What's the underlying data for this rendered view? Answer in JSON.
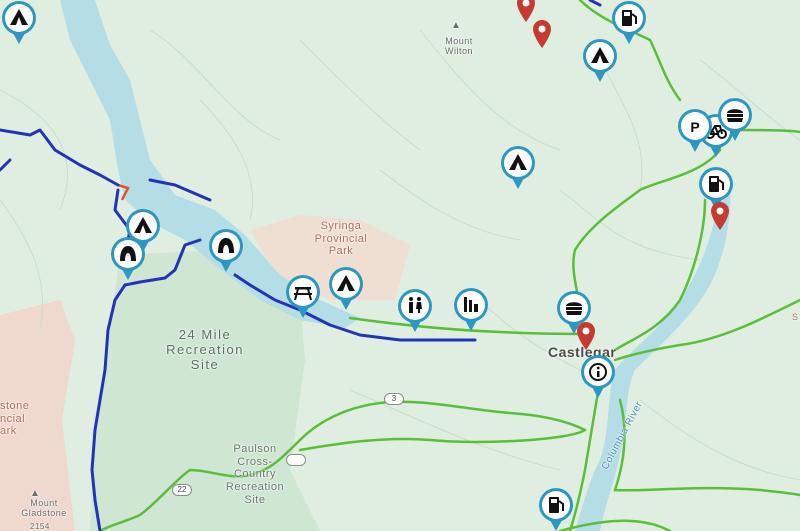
{
  "map": {
    "labels": {
      "mount_wilton": "Mount\nWilton",
      "syringa_park": "Syringa\nProvincial\nPark",
      "recreation_site": "24 Mile\nRecreation\nSite",
      "paulson_site": "Paulson\nCross-\nCountry\nRecreation\nSite",
      "mount_gladstone": "Mount\nGladstone",
      "gladstone_elev": "2154",
      "castlegar": "Castlegar",
      "columbia_river": "Columbia River",
      "left_park": "stone\nncial\nark",
      "route_3": "3",
      "route_22": "22",
      "route_right": "S"
    },
    "marker_icons": [
      "campground-icon",
      "campground-icon",
      "campground-icon",
      "campground-icon",
      "cave-icon",
      "cave-icon",
      "picnic-table-icon",
      "campground-icon",
      "restroom-icon",
      "boat-launch-icon",
      "food-icon",
      "info-icon",
      "gas-station-icon",
      "gas-station-icon",
      "gas-station-icon",
      "bicycle-icon",
      "food-icon",
      "parking-icon"
    ],
    "colors": {
      "land": "#dfeee0",
      "water": "#b5dde6",
      "park_green": "#cfe6d3",
      "park_pink": "#efd9cf",
      "trail_green": "#5cbd3a",
      "route_blue": "#2233b8",
      "marker_ring": "#2c97c2",
      "pin_red": "#c43b32"
    }
  }
}
